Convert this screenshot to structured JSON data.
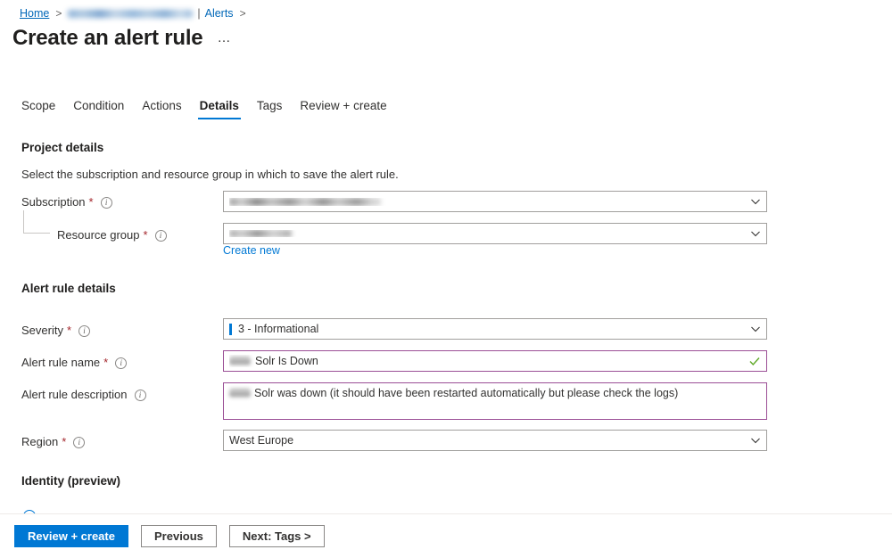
{
  "breadcrumb": {
    "home_label": "Home",
    "redacted_resource": "",
    "alerts_label": "Alerts",
    "separator": ">",
    "pipe": "|"
  },
  "header": {
    "title": "Create an alert rule",
    "ellipsis_label": "…"
  },
  "tabs": [
    {
      "label": "Scope",
      "active": false
    },
    {
      "label": "Condition",
      "active": false
    },
    {
      "label": "Actions",
      "active": false
    },
    {
      "label": "Details",
      "active": true
    },
    {
      "label": "Tags",
      "active": false
    },
    {
      "label": "Review + create",
      "active": false
    }
  ],
  "project_details": {
    "heading": "Project details",
    "description": "Select the subscription and resource group in which to save the alert rule.",
    "subscription": {
      "label": "Subscription",
      "required": "*",
      "value": "",
      "redacted": true
    },
    "resource_group": {
      "label": "Resource group",
      "required": "*",
      "value": "",
      "redacted": true,
      "create_new_link": "Create new"
    }
  },
  "alert_rule_details": {
    "heading": "Alert rule details",
    "severity": {
      "label": "Severity",
      "required": "*",
      "value": "3 - Informational"
    },
    "alert_rule_name": {
      "label": "Alert rule name",
      "required": "*",
      "value": "Solr Is Down",
      "valid": true
    },
    "alert_rule_description": {
      "label": "Alert rule description",
      "required": "",
      "value": "Solr was down (it should have been restarted automatically but please check the logs)"
    },
    "region": {
      "label": "Region",
      "required": "*",
      "value": "West Europe"
    }
  },
  "identity": {
    "heading": "Identity (preview)"
  },
  "footer": {
    "review_create_label": "Review + create",
    "previous_label": "Previous",
    "next_label": "Next: Tags >"
  },
  "colors": {
    "accent": "#0078d4",
    "link": "#0067b8",
    "required_asterisk": "#a4262c",
    "focus_border": "#9b4f96",
    "valid_check": "#5ea826",
    "border": "#a19f9d"
  }
}
